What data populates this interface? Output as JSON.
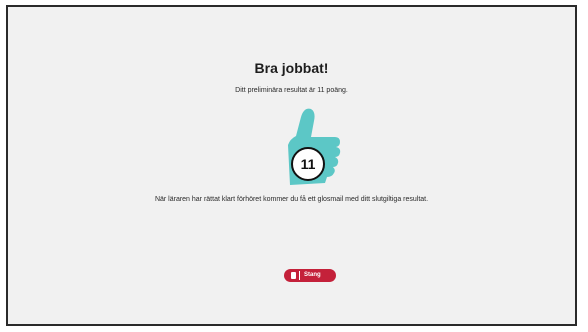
{
  "result": {
    "title": "Bra jobbat!",
    "subtitle": "Ditt preliminära resultat är 11 poäng.",
    "score": "11",
    "info": "När läraren har rättat klart förhöret kommer du få ett glosmail med ditt slutgiltiga resultat."
  },
  "actions": {
    "close_label": "Stang"
  },
  "icons": {
    "thumb": "thumbs-up-icon",
    "close": "document-icon"
  },
  "colors": {
    "thumb": "#5cc7c6",
    "button": "#c4213a",
    "background": "#f1f1f1"
  }
}
